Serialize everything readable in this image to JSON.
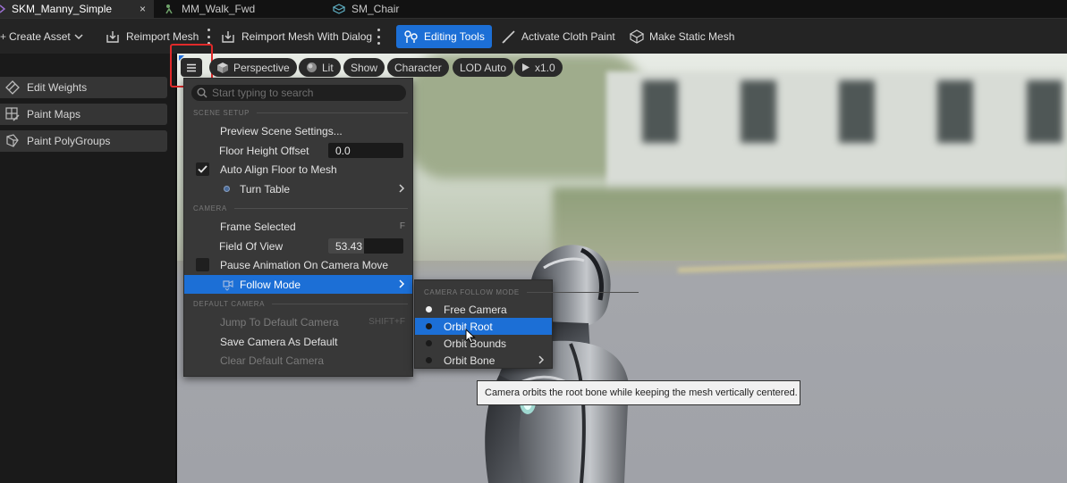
{
  "tabs": [
    {
      "label": "SKM_Manny_Simple",
      "active": true,
      "icon": "skeletal-mesh-icon"
    },
    {
      "label": "MM_Walk_Fwd",
      "active": false,
      "icon": "animation-icon"
    },
    {
      "label": "SM_Chair",
      "active": false,
      "icon": "static-mesh-icon"
    }
  ],
  "tab_close": "×",
  "toolbar": {
    "create_asset": "Create Asset",
    "reimport_mesh": "Reimport Mesh",
    "reimport_with_dialog": "Reimport Mesh With Dialog",
    "editing_tools": "Editing Tools",
    "activate_cloth_paint": "Activate Cloth Paint",
    "make_static_mesh": "Make Static Mesh"
  },
  "left_panel": {
    "items": [
      "Edit Weights",
      "Paint Maps",
      "Paint PolyGroups"
    ]
  },
  "viewport_bar": {
    "perspective": "Perspective",
    "lit": "Lit",
    "show": "Show",
    "character": "Character",
    "lod": "LOD Auto",
    "speed": "x1.0"
  },
  "menu": {
    "search_placeholder": "Start typing to search",
    "scene_setup_header": "SCENE SETUP",
    "preview_scene_settings": "Preview Scene Settings...",
    "floor_height_offset": "Floor Height Offset",
    "floor_height_value": "0.0",
    "auto_align_floor": "Auto Align Floor to Mesh",
    "auto_align_checked": true,
    "turn_table": "Turn Table",
    "camera_header": "CAMERA",
    "frame_selected": "Frame Selected",
    "frame_selected_shortcut": "F",
    "field_of_view": "Field Of View",
    "field_of_view_value": "53.43",
    "pause_animation": "Pause Animation On Camera Move",
    "pause_animation_checked": false,
    "follow_mode": "Follow Mode",
    "default_camera_header": "DEFAULT CAMERA",
    "jump_to_default": "Jump To Default Camera",
    "jump_shortcut": "SHIFT+F",
    "save_camera_default": "Save Camera As Default",
    "clear_default_camera": "Clear Default Camera"
  },
  "submenu": {
    "header": "CAMERA FOLLOW MODE",
    "items": [
      "Free Camera",
      "Orbit Root",
      "Orbit Bounds",
      "Orbit Bone"
    ],
    "selected_index": 0,
    "hover_index": 1
  },
  "tooltip": "Camera orbits the root bone while keeping the mesh vertically centered.",
  "colors": {
    "accent": "#1c6fd6",
    "highlight_box": "#e02a2a"
  }
}
